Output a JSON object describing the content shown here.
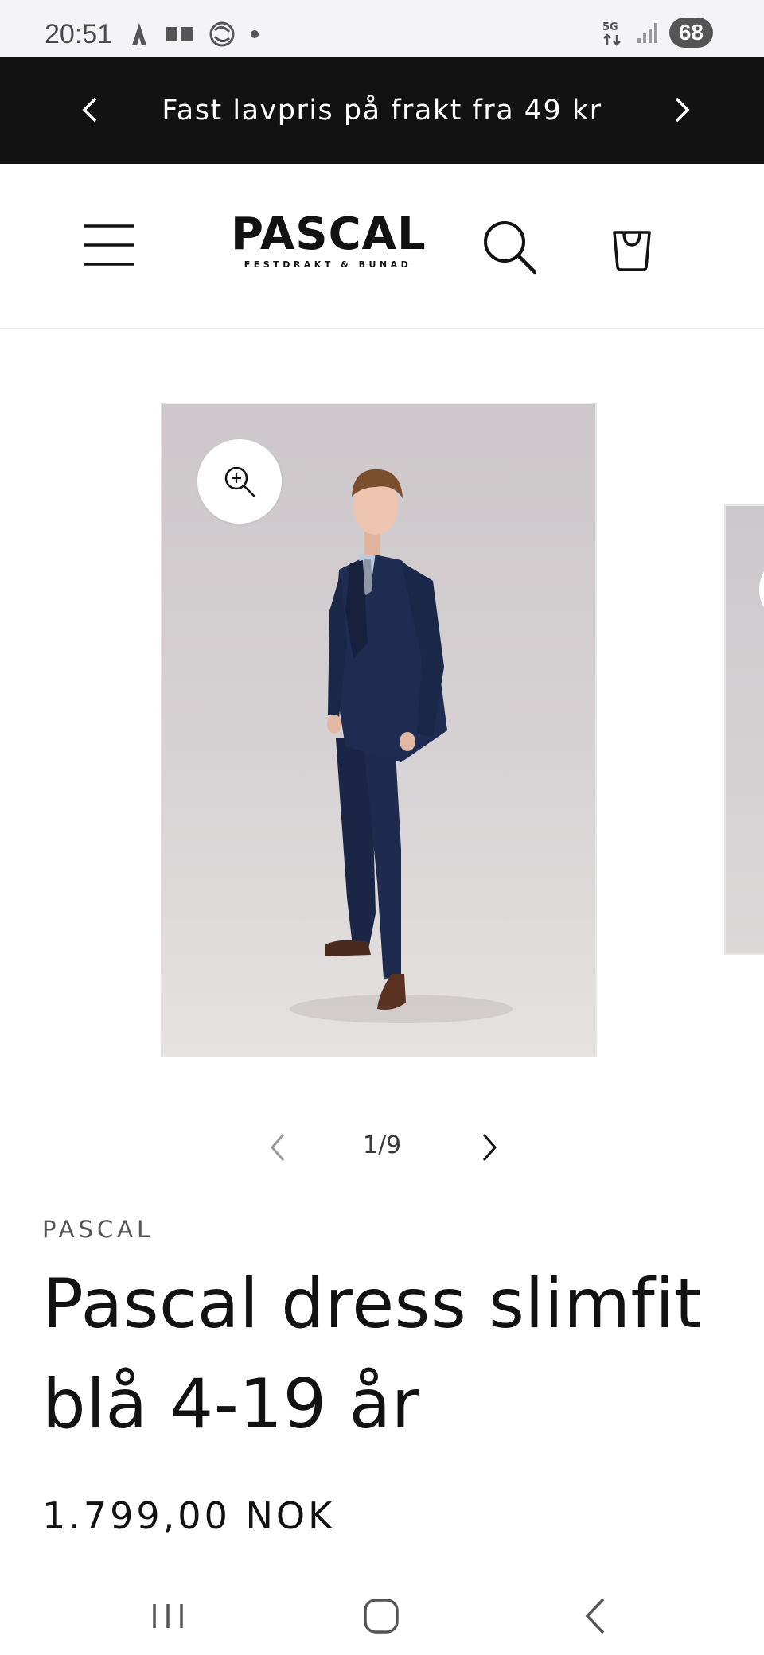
{
  "status_bar": {
    "time": "20:51",
    "network": "5G",
    "battery": "68"
  },
  "announcement": {
    "text": "Fast lavpris på frakt fra 49 kr"
  },
  "header": {
    "logo_text": "PASCAL",
    "logo_tagline": "FESTDRAKT & BUNAD"
  },
  "gallery": {
    "counter": "1/9"
  },
  "product": {
    "vendor": "PASCAL",
    "title": "Pascal dress slimfit blå 4-19 år",
    "price": "1.799,00 NOK"
  },
  "colors": {
    "announcement_bg": "#121212",
    "text": "#121212",
    "suit_navy": "#1d2a4d"
  },
  "icons": [
    "chevron-left-icon",
    "chevron-right-icon",
    "menu-icon",
    "search-icon",
    "cart-icon",
    "zoom-icon",
    "recents-icon",
    "home-icon",
    "back-icon"
  ]
}
